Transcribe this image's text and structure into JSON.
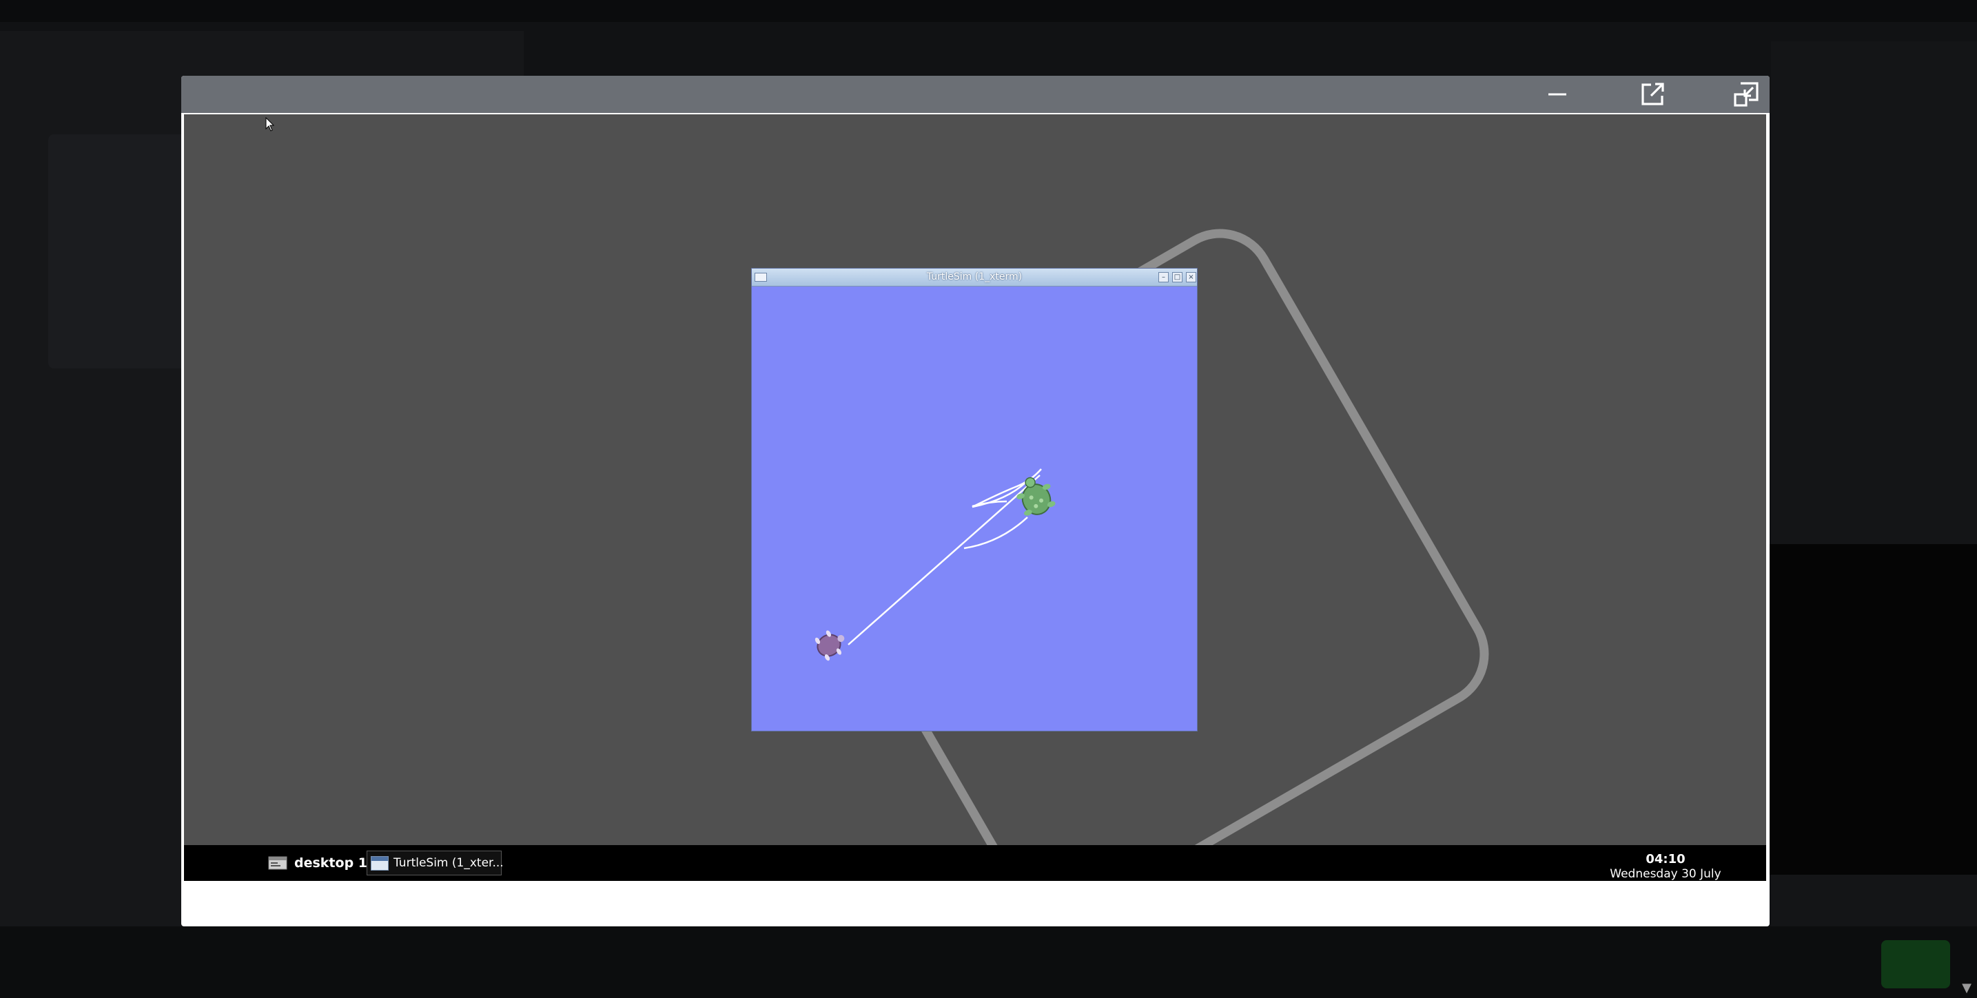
{
  "modal": {
    "header_buttons": [
      {
        "icon": "minimize-icon"
      },
      {
        "icon": "open-in-new-window-icon"
      },
      {
        "icon": "restore-window-icon"
      }
    ]
  },
  "turtlesim_window": {
    "title": "TurtleSim (1_xterm)",
    "background_color": "#8088f9"
  },
  "taskbar": {
    "desktop_label": "desktop 1",
    "task_label": "TurtleSim (1_xter...",
    "time": "04:10",
    "date": "Wednesday 30 July"
  },
  "colors": {
    "header": "#6b6f75",
    "vnc_desktop": "#505050",
    "taskbar": "#000000"
  }
}
